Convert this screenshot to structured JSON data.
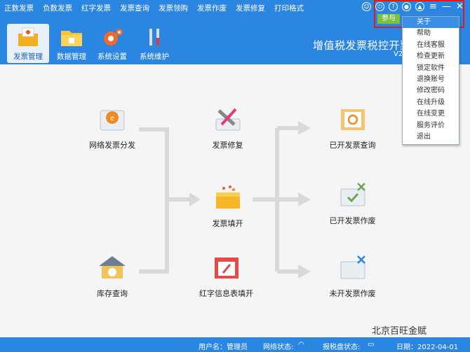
{
  "menu": [
    "正数发票",
    "负数发票",
    "红字发票",
    "发票查询",
    "发票领购",
    "发票作废",
    "发票修复",
    "打印格式"
  ],
  "toolbar": [
    {
      "label": "发票管理",
      "icon": "invoice-box-icon",
      "active": true
    },
    {
      "label": "数据管理",
      "icon": "folder-icon",
      "active": false
    },
    {
      "label": "系统设置",
      "icon": "gear-icon",
      "active": false
    },
    {
      "label": "系统维护",
      "icon": "tools-icon",
      "active": false
    }
  ],
  "title": "增值税发票税控开票",
  "version": "V2",
  "highlight_badge": "参与",
  "dropdown": [
    "关于",
    "帮助",
    "在线客服",
    "检查更新",
    "锁定软件",
    "退换账号",
    "修改密码",
    "在线升级",
    "在线变更",
    "服务评价",
    "退出"
  ],
  "flow": {
    "nodes": {
      "distribution": "网络发票分发",
      "repair": "发票修复",
      "fill": "发票填开",
      "stock": "库存查询",
      "red_info": "红字信息表填开",
      "issued_query": "已开发票查询",
      "issued_void": "已开发票作废",
      "unissued_void": "未开发票作废"
    }
  },
  "status": {
    "user_label": "用户名：管理员",
    "network_label": "网络状态:",
    "tax_label": "报税盘状态:",
    "date_label": "日期：2022-04-01"
  },
  "watermark": "北京百旺金赋",
  "colors": {
    "accent": "#2a86e0",
    "highlight": "#e21818",
    "arrow": "#d9d9d9"
  }
}
